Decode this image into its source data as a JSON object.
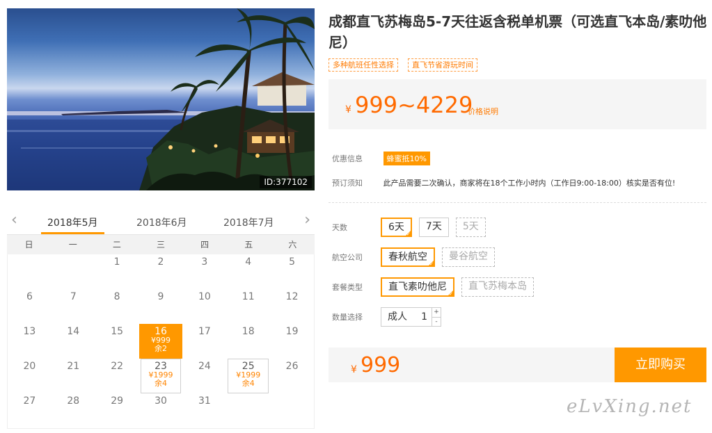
{
  "hero": {
    "image_id": "ID:377102"
  },
  "calendar": {
    "prev_arrow": "‹",
    "next_arrow": "›",
    "months": [
      "2018年5月",
      "2018年6月",
      "2018年7月"
    ],
    "weekdays": [
      "日",
      "一",
      "二",
      "三",
      "四",
      "五",
      "六"
    ],
    "days": [
      {
        "d": ""
      },
      {
        "d": ""
      },
      {
        "d": "1"
      },
      {
        "d": "2"
      },
      {
        "d": "3"
      },
      {
        "d": "4"
      },
      {
        "d": "5"
      },
      {
        "d": "6"
      },
      {
        "d": "7"
      },
      {
        "d": "8"
      },
      {
        "d": "9"
      },
      {
        "d": "10"
      },
      {
        "d": "11"
      },
      {
        "d": "12"
      },
      {
        "d": "13"
      },
      {
        "d": "14"
      },
      {
        "d": "15"
      },
      {
        "d": "16",
        "price": "¥999",
        "remain": "余2",
        "selected": true
      },
      {
        "d": "17"
      },
      {
        "d": "18"
      },
      {
        "d": "19"
      },
      {
        "d": "20"
      },
      {
        "d": "21"
      },
      {
        "d": "22"
      },
      {
        "d": "23",
        "price": "¥1999",
        "remain": "余4"
      },
      {
        "d": "24"
      },
      {
        "d": "25",
        "price": "¥1999",
        "remain": "余4"
      },
      {
        "d": "26"
      },
      {
        "d": "27"
      },
      {
        "d": "28"
      },
      {
        "d": "29"
      },
      {
        "d": "30"
      },
      {
        "d": "31"
      },
      {
        "d": ""
      },
      {
        "d": ""
      }
    ]
  },
  "product": {
    "title": "成都直飞苏梅岛5-7天往返含税单机票（可选直飞本岛/素叻他尼）",
    "tags": [
      "多种航班任性选择",
      "直飞节省游玩时间"
    ],
    "currency": "¥",
    "price_range": "999~4229",
    "price_note": "价格说明"
  },
  "info": {
    "promo_label": "优惠信息",
    "promo_badge": "蜂蜜抵10%",
    "booking_label": "预订须知",
    "booking_text": "此产品需要二次确认，商家将在18个工作小时内（工作日9:00-18:00）核实是否有位!"
  },
  "options": {
    "days": {
      "label": "天数",
      "items": [
        {
          "text": "6天",
          "state": "sel"
        },
        {
          "text": "7天",
          "state": ""
        },
        {
          "text": "5天",
          "state": "dis"
        }
      ]
    },
    "airline": {
      "label": "航空公司",
      "items": [
        {
          "text": "春秋航空",
          "state": "sel"
        },
        {
          "text": "曼谷航空",
          "state": "dis"
        }
      ]
    },
    "package": {
      "label": "套餐类型",
      "items": [
        {
          "text": "直飞素叻他尼",
          "state": "sel"
        },
        {
          "text": "直飞苏梅本岛",
          "state": "dis"
        }
      ]
    },
    "quantity": {
      "label": "数量选择",
      "type": "成人",
      "value": "1",
      "plus": "+",
      "minus": "-"
    }
  },
  "buy": {
    "currency": "¥",
    "total": "999",
    "button": "立即购买"
  },
  "watermark": "eLvXing.net",
  "colors": {
    "accent": "#ff9800",
    "price": "#ff6a00"
  }
}
